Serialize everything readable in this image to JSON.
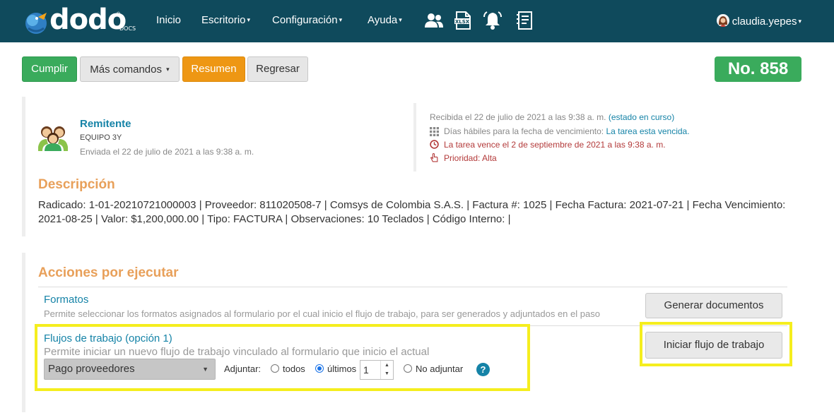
{
  "brand": {
    "name": "dodo",
    "sub": "DOCS",
    "reg": "®"
  },
  "nav": {
    "items": [
      {
        "label": "Inicio",
        "caret": ""
      },
      {
        "label": "Escritorio",
        "caret": "▾"
      },
      {
        "label": "Configuración",
        "caret": "▾"
      },
      {
        "label": "Ayuda",
        "caret": "▾"
      }
    ],
    "icons": [
      "users-icon",
      "xlsx-file-icon",
      "bell-icon",
      "notes-icon"
    ],
    "user": "claudia.yepes",
    "user_caret": "▾"
  },
  "toolbar": {
    "cumplir": "Cumplir",
    "mas_comandos": "Más comandos",
    "mas_caret": "▾",
    "resumen": "Resumen",
    "regresar": "Regresar",
    "number": "No. 858"
  },
  "sender": {
    "title": "Remitente",
    "team": "EQUIPO 3Y",
    "sent": "Enviada el 22 de julio de 2021 a las 9:38 a. m."
  },
  "meta": {
    "received": "Recibida el 22 de julio de 2021 a las 9:38 a. m.",
    "status": "(estado en curso)",
    "days_label": "Días hábiles para la fecha de vencimiento:",
    "days_value": "La tarea esta vencida.",
    "due": "La tarea vence el 2 de septiembre de 2021 a las 9:38 a. m.",
    "priority": "Prioridad: Alta"
  },
  "description": {
    "title": "Descripción",
    "line1": "Radicado: 1-01-20210721000003 | Proveedor: 811020508-7 | Comsys de Colombia S.A.S. | Factura #: 1025 | Fecha Factura: 2021-07-21 | Fecha Vencimiento:",
    "line2": "2021-08-25 | Valor: $1,200,000.00 | Tipo: FACTURA | Observaciones: 10 Teclados | Código Interno: |"
  },
  "actions": {
    "title": "Acciones por ejecutar",
    "formatos": {
      "title": "Formatos",
      "desc": "Permite seleccionar los formatos asignados al formulario por el cual inicio el flujo de trabajo, para ser generados y adjuntados en el paso",
      "button": "Generar documentos"
    },
    "flujos": {
      "title": "Flujos de trabajo (opción 1)",
      "desc": "Permite iniciar un nuevo flujo de trabajo vinculado al formulario que inicio el actual",
      "select_value": "Pago proveedores",
      "adjuntar_label": "Adjuntar:",
      "opt_todos": "todos",
      "opt_ultimos": "últimos",
      "ultimos_value": "1",
      "opt_no": "No adjuntar",
      "selected_option": "últimos",
      "help": "?",
      "button": "Iniciar flujo de trabajo"
    }
  },
  "colors": {
    "navbar": "#0f4a5c",
    "accent_blue": "#1583a7",
    "green": "#3aab5c",
    "orange": "#ee9714",
    "section_title": "#e8a05a",
    "highlight": "#f5ee1e"
  }
}
